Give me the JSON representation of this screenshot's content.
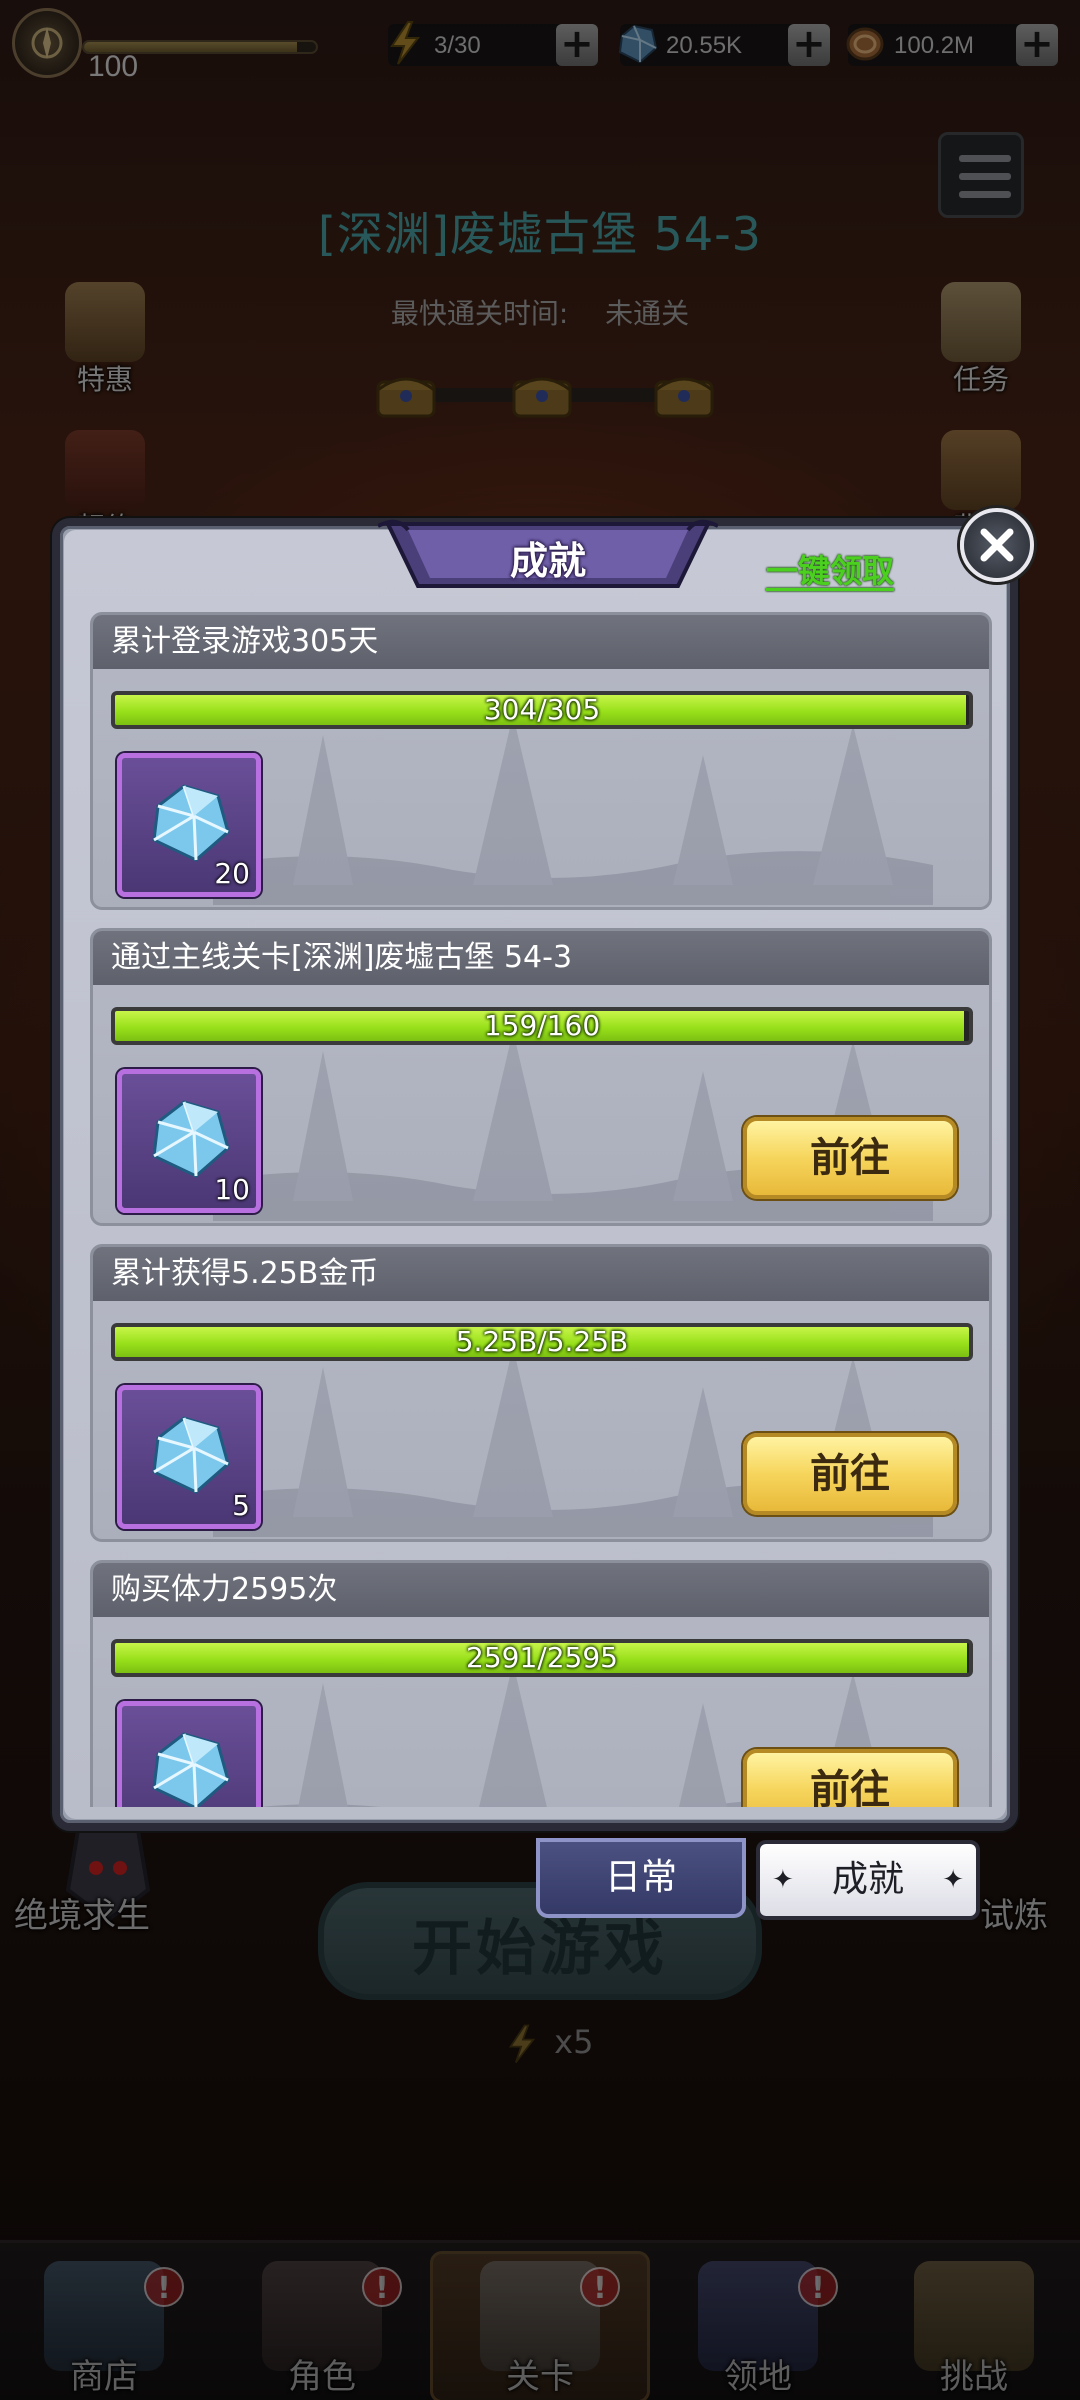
{
  "top_bar": {
    "level": "100",
    "stamina": "3/30",
    "gems": "20.55K",
    "gold": "100.2M",
    "plus_label": "+"
  },
  "stage": {
    "title": "[深渊]废墟古堡 54-3",
    "best_time_label": "最快通关时间:",
    "best_time_value": "未通关"
  },
  "side_buttons": {
    "left": [
      "特惠",
      "契约"
    ],
    "right": [
      "任务",
      "背包"
    ]
  },
  "modal": {
    "title": "成就",
    "claim_all": "一键领取",
    "go_label": "前往",
    "achievements": [
      {
        "title": "累计登录游戏305天",
        "progress_text": "304/305",
        "progress": 0.997,
        "reward_qty": "20",
        "show_go": false
      },
      {
        "title": "通过主线关卡[深渊]废墟古堡 54-3",
        "progress_text": "159/160",
        "progress": 0.994,
        "reward_qty": "10",
        "show_go": true
      },
      {
        "title": "累计获得5.25B金币",
        "progress_text": "5.25B/5.25B",
        "progress": 1.0,
        "reward_qty": "5",
        "show_go": true
      },
      {
        "title": "购买体力2595次",
        "progress_text": "2591/2595",
        "progress": 0.998,
        "reward_qty": "",
        "show_go": true
      }
    ]
  },
  "tabs": {
    "daily": "日常",
    "achievement": "成就",
    "star": "✦"
  },
  "behind": {
    "start_game": "开始游戏",
    "energy_cost": "x5",
    "survival": "绝境求生",
    "trial": "试炼"
  },
  "bottom_nav": {
    "items": [
      {
        "label": "商店",
        "badge": "!"
      },
      {
        "label": "角色",
        "badge": "!"
      },
      {
        "label": "关卡",
        "badge": "!"
      },
      {
        "label": "领地",
        "badge": "!"
      },
      {
        "label": "挑战",
        "badge": ""
      }
    ]
  },
  "colors": {
    "progress_fill": "#98e01a",
    "go_button": "#f6d55c",
    "stage_title": "#4aa1a3",
    "claim_all": "#4bd01f"
  },
  "icons": {
    "stamina": "lightning-icon",
    "gems": "gem-icon",
    "gold": "coin-icon",
    "reward": "diamond-icon",
    "close": "close-icon",
    "menu": "menu-icon"
  }
}
